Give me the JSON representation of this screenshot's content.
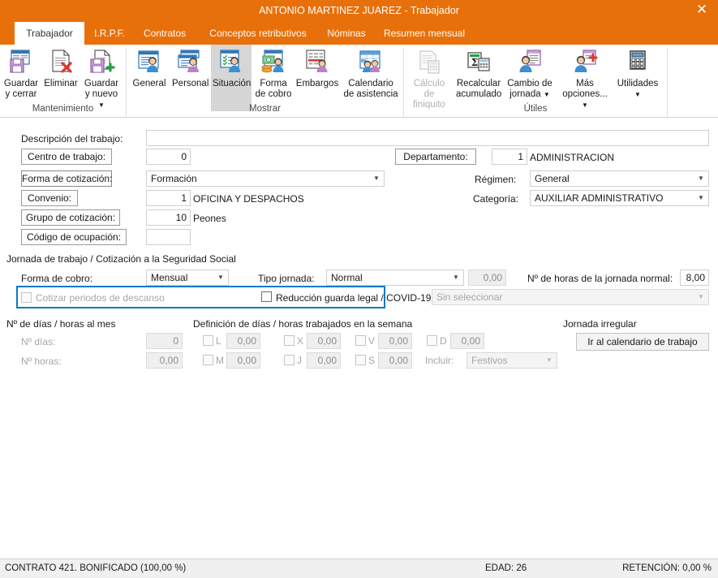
{
  "window": {
    "title": "ANTONIO MARTINEZ JUAREZ - Trabajador",
    "close_label": "✕",
    "accent_color": "#e8700a",
    "focus_color": "#0b7ac4"
  },
  "tabs": [
    {
      "label": "Trabajador",
      "active": true
    },
    {
      "label": "I.R.P.F.",
      "active": false
    },
    {
      "label": "Contratos",
      "active": false
    },
    {
      "label": "Conceptos retributivos",
      "active": false
    },
    {
      "label": "Nóminas",
      "active": false
    },
    {
      "label": "Resumen mensual",
      "active": false
    }
  ],
  "ribbon": {
    "groups": [
      {
        "label": "Mantenimiento"
      },
      {
        "label": "Mostrar"
      },
      {
        "label": "Útiles"
      }
    ],
    "items": [
      {
        "label": "Guardar\ny cerrar",
        "icon": "save-close-icon",
        "state": "normal",
        "caret": false
      },
      {
        "label": "Eliminar",
        "icon": "delete-document-icon",
        "state": "normal",
        "caret": false
      },
      {
        "label": "Guardar\ny nuevo",
        "icon": "save-new-icon",
        "state": "normal",
        "caret": true
      },
      {
        "label": "General",
        "icon": "general-person-icon",
        "state": "normal",
        "caret": false
      },
      {
        "label": "Personal",
        "icon": "personal-person-icon",
        "state": "normal",
        "caret": false
      },
      {
        "label": "Situación",
        "icon": "situation-person-icon",
        "state": "selected",
        "caret": false
      },
      {
        "label": "Forma\nde cobro",
        "icon": "payment-coins-icon",
        "state": "normal",
        "caret": false
      },
      {
        "label": "Embargos",
        "icon": "garnishment-icon",
        "state": "normal",
        "caret": false
      },
      {
        "label": "Calendario\nde asistencia",
        "icon": "attendance-calendar-icon",
        "state": "normal",
        "caret": false
      },
      {
        "label": "Cálculo de\nfiniquito",
        "icon": "settlement-calc-icon",
        "state": "disabled",
        "caret": false
      },
      {
        "label": "Recalcular\nacumulado",
        "icon": "recalculate-sigma-icon",
        "state": "normal",
        "caret": false
      },
      {
        "label": "Cambio de\njornada",
        "icon": "workday-change-icon",
        "state": "normal",
        "caret": true
      },
      {
        "label": "Más\nopciones...",
        "icon": "more-options-icon",
        "state": "normal",
        "caret": true
      },
      {
        "label": "Utilidades",
        "icon": "utilities-calculator-icon",
        "state": "normal",
        "caret": true
      }
    ]
  },
  "form": {
    "descripcion_label": "Descripción del trabajo:",
    "descripcion_value": "",
    "centro_label": "Centro de trabajo:",
    "centro_value": "0",
    "departamento_label": "Departamento:",
    "departamento_code": "1",
    "departamento_name": "ADMINISTRACION",
    "forma_cotizacion_label": "Forma de cotización:",
    "forma_cotizacion_value": "Formación",
    "regimen_label": "Régimen:",
    "regimen_value": "General",
    "convenio_label": "Convenio:",
    "convenio_code": "1",
    "convenio_name": "OFICINA Y DESPACHOS",
    "categoria_label": "Categoría:",
    "categoria_value": "AUXILIAR ADMINISTRATIVO",
    "grupo_label": "Grupo de cotización:",
    "grupo_code": "10",
    "grupo_name": "Peones",
    "codigo_ocupacion_label": "Código de ocupación:",
    "codigo_ocupacion_value": ""
  },
  "jornada": {
    "section_title": "Jornada de trabajo / Cotización a la Seguridad Social",
    "forma_cobro_label": "Forma de cobro:",
    "forma_cobro_value": "Mensual",
    "cotizar_descanso_label": "Cotizar periodos de descanso",
    "cotizar_descanso_checked": false,
    "tipo_jornada_label": "Tipo jornada:",
    "tipo_jornada_value": "Normal",
    "tipo_jornada_num": "0,00",
    "horas_normal_label": "Nº de horas de la jornada normal:",
    "horas_normal_value": "8,00",
    "reduccion_label": "Reducción guarda legal / COVID-19",
    "reduccion_checked": false,
    "reduccion_combo_value": "Sin seleccionar"
  },
  "dias_mes": {
    "section_title": "Nº de días / horas al mes",
    "dias_label": "Nº días:",
    "dias_value": "0",
    "horas_label": "Nº horas:",
    "horas_value": "0,00"
  },
  "semana": {
    "section_title": "Definición de días / horas trabajados en la semana",
    "days": [
      {
        "code": "L",
        "value": "0,00",
        "checked": false
      },
      {
        "code": "M",
        "value": "0,00",
        "checked": false
      },
      {
        "code": "X",
        "value": "0,00",
        "checked": false
      },
      {
        "code": "J",
        "value": "0,00",
        "checked": false
      },
      {
        "code": "V",
        "value": "0,00",
        "checked": false
      },
      {
        "code": "S",
        "value": "0,00",
        "checked": false
      },
      {
        "code": "D",
        "value": "0,00",
        "checked": false
      }
    ],
    "incluir_label": "Incluir:",
    "incluir_value": "Festivos"
  },
  "jornada_irregular": {
    "section_title": "Jornada irregular",
    "button_label": "Ir al calendario de trabajo"
  },
  "statusbar": {
    "contrato": "CONTRATO 421.  BONIFICADO (100,00 %)",
    "edad": "EDAD: 26",
    "retencion": "RETENCIÓN: 0,00 %"
  }
}
